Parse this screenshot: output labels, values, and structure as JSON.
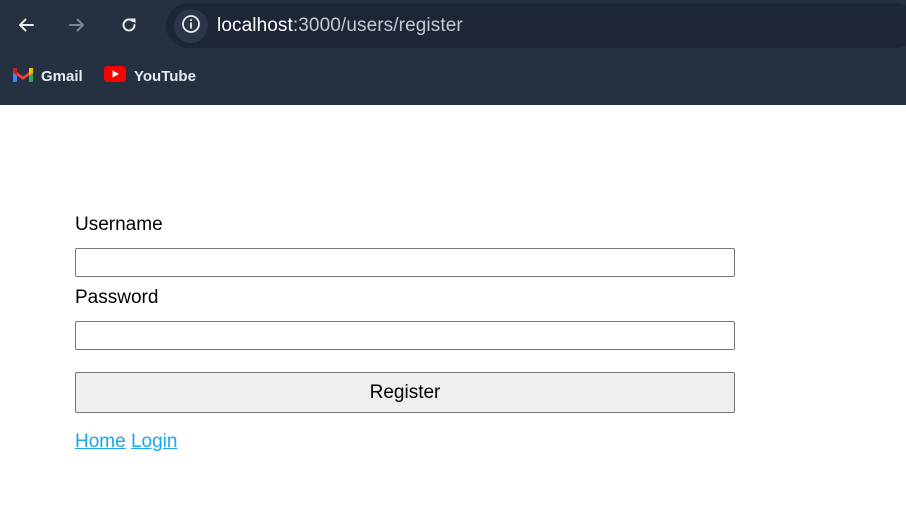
{
  "browser": {
    "url_host": "localhost",
    "url_path": ":3000/users/register",
    "bookmarks": [
      {
        "label": "Gmail",
        "icon": "gmail-icon"
      },
      {
        "label": "YouTube",
        "icon": "youtube-icon"
      }
    ],
    "nav_icons": [
      "back-arrow-icon",
      "forward-arrow-icon",
      "reload-icon",
      "site-info-icon"
    ],
    "colors": {
      "chrome_bg": "#253041",
      "omnibox_bg": "#1c2637",
      "link": "#1aa7e8"
    }
  },
  "form": {
    "username_label": "Username",
    "username_value": "",
    "password_label": "Password",
    "password_value": "",
    "submit_label": "Register"
  },
  "nav_links": {
    "home": "Home",
    "login": "Login"
  }
}
